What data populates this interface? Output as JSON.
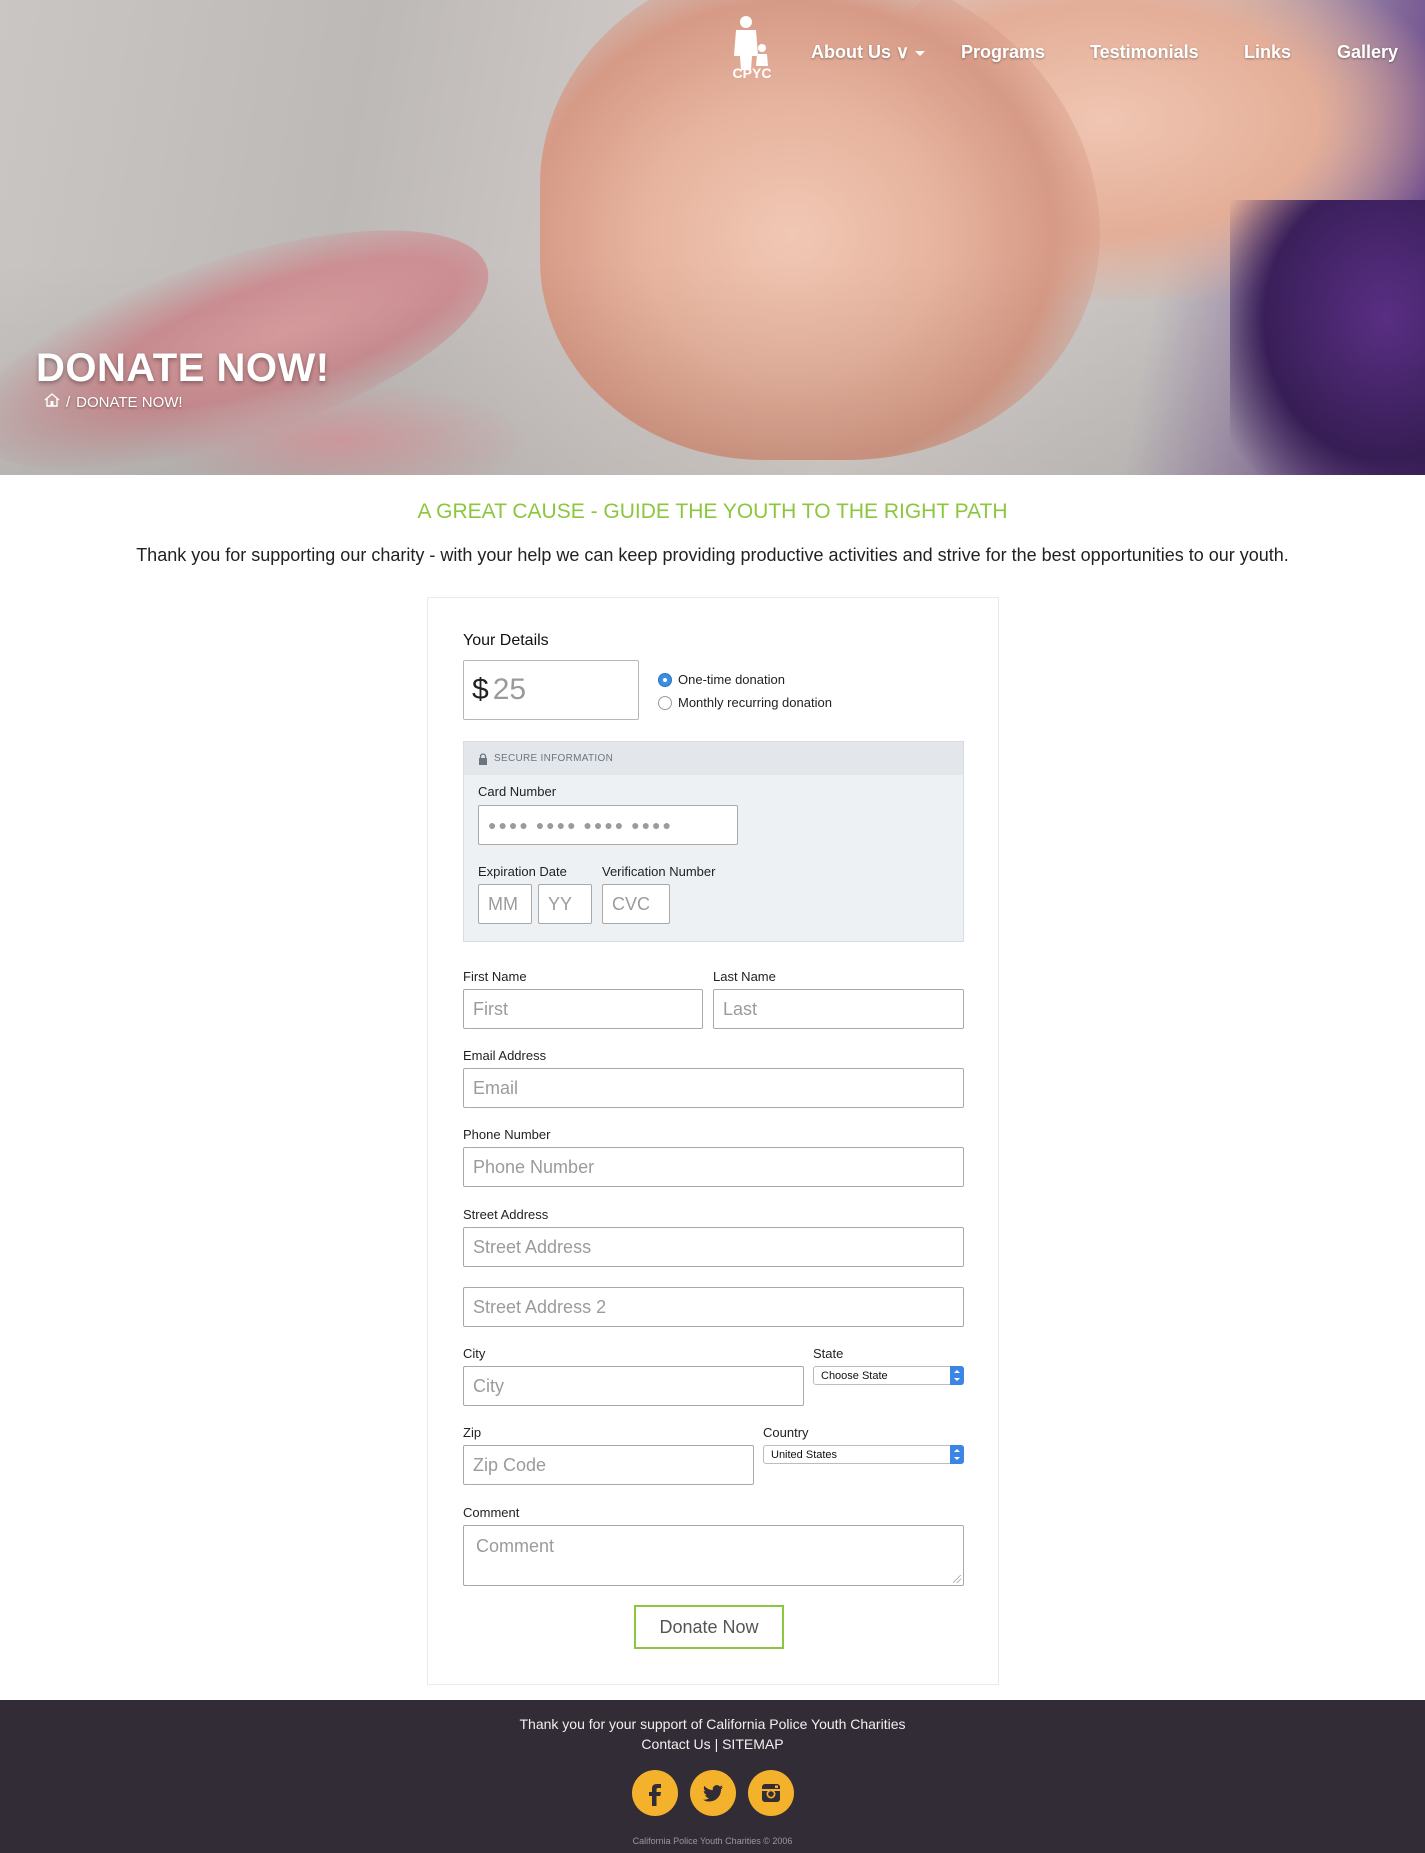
{
  "nav": {
    "logo_text": "CPYC",
    "items": [
      {
        "label": "About Us ∨"
      },
      {
        "label": "Programs"
      },
      {
        "label": "Testimonials"
      },
      {
        "label": "Links"
      },
      {
        "label": "Gallery"
      }
    ]
  },
  "hero": {
    "title": "DONATE NOW!",
    "breadcrumb_sep": "/",
    "breadcrumb_current": "DONATE NOW!"
  },
  "intro": {
    "headline": "A GREAT CAUSE - GUIDE THE YOUTH TO THE RIGHT PATH",
    "text": "Thank you for supporting our charity - with your help we can keep providing productive activities and strive for the best opportunities to our youth."
  },
  "form": {
    "section_title": "Your Details",
    "amount": {
      "currency": "$",
      "value": "25"
    },
    "frequency": {
      "options": [
        "One-time donation",
        "Monthly recurring donation"
      ],
      "selected": "One-time donation"
    },
    "secure": {
      "header": "SECURE INFORMATION",
      "card_number_label": "Card Number",
      "card_number_placeholder": "●●●● ●●●● ●●●● ●●●●",
      "expiration_label": "Expiration Date",
      "month_placeholder": "MM",
      "year_placeholder": "YY",
      "verification_label": "Verification Number",
      "cvc_placeholder": "CVC"
    },
    "first_name": {
      "label": "First Name",
      "placeholder": "First"
    },
    "last_name": {
      "label": "Last Name",
      "placeholder": "Last"
    },
    "email": {
      "label": "Email Address",
      "placeholder": "Email"
    },
    "phone": {
      "label": "Phone Number",
      "placeholder": "Phone Number"
    },
    "street": {
      "label": "Street Address",
      "placeholder": "Street Address"
    },
    "street2": {
      "placeholder": "Street Address 2"
    },
    "city": {
      "label": "City",
      "placeholder": "City"
    },
    "state": {
      "label": "State",
      "value": "Choose State"
    },
    "zip": {
      "label": "Zip",
      "placeholder": "Zip Code"
    },
    "country": {
      "label": "Country",
      "value": "United States"
    },
    "comment": {
      "label": "Comment",
      "placeholder": "Comment"
    },
    "submit_label": "Donate Now"
  },
  "footer": {
    "thanks": "Thank you for your support of California Police Youth Charities",
    "contact": "Contact Us",
    "separator": "|",
    "sitemap": "SITEMAP",
    "social": [
      "facebook-icon",
      "twitter-icon",
      "instagram-icon"
    ],
    "copyright": "California Police Youth Charities © 2006"
  },
  "colors": {
    "accent_green": "#8cc63f",
    "footer_bg": "#312c35",
    "social_yellow": "#f4b22c",
    "radio_blue": "#3a8ee6"
  }
}
